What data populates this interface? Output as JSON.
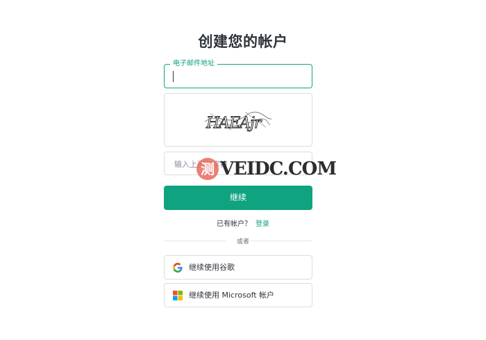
{
  "title": "创建您的帐户",
  "email": {
    "label": "电子邮件地址",
    "value": ""
  },
  "captcha": {
    "text": "HAEAjr",
    "placeholder": "输入上面的字符"
  },
  "watermark": {
    "circle": "测",
    "text": "VEIDC.COM"
  },
  "continue_label": "继续",
  "have_account": {
    "question": "已有帐户？",
    "login_link": "登录"
  },
  "divider_text": "或者",
  "social": {
    "google_label": "继续使用谷歌",
    "microsoft_label": "继续使用 Microsoft 帐户"
  },
  "colors": {
    "accent": "#10a37f",
    "border": "#dcdcdc",
    "text": "#2d333a"
  },
  "icons": {
    "google": "google-icon",
    "microsoft": "microsoft-icon"
  }
}
